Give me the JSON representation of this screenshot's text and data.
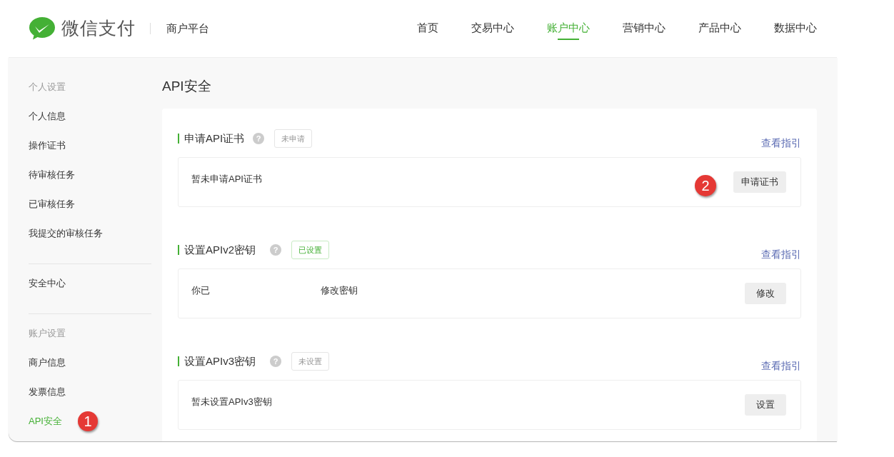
{
  "header": {
    "logo_text": "微信支付",
    "platform": "商户平台",
    "nav": [
      {
        "label": "首页",
        "selected": false
      },
      {
        "label": "交易中心",
        "selected": false
      },
      {
        "label": "账户中心",
        "selected": true
      },
      {
        "label": "营销中心",
        "selected": false
      },
      {
        "label": "产品中心",
        "selected": false
      },
      {
        "label": "数据中心",
        "selected": false
      }
    ]
  },
  "sidebar": {
    "groups": [
      {
        "heading": "个人设置",
        "items": [
          {
            "label": "个人信息",
            "selected": false
          },
          {
            "label": "操作证书",
            "selected": false
          },
          {
            "label": "待审核任务",
            "selected": false
          },
          {
            "label": "已审核任务",
            "selected": false
          },
          {
            "label": "我提交的审核任务",
            "selected": false
          }
        ]
      },
      {
        "items": [
          {
            "label": "安全中心",
            "selected": false
          }
        ]
      },
      {
        "heading": "账户设置",
        "items": [
          {
            "label": "商户信息",
            "selected": false
          },
          {
            "label": "发票信息",
            "selected": false
          },
          {
            "label": "API安全",
            "selected": true,
            "badge": "1"
          }
        ]
      }
    ]
  },
  "page_title": "API安全",
  "sections": [
    {
      "title": "申请API证书",
      "help": "?",
      "tag": {
        "text": "未申请",
        "set": false
      },
      "guide": "查看指引",
      "texts": [
        "暂未申请API证书"
      ],
      "button": "申请证书",
      "badge": "2"
    },
    {
      "title": "设置APIv2密钥",
      "help": "?",
      "tag": {
        "text": "已设置",
        "set": true
      },
      "guide": "查看指引",
      "texts": [
        "你已",
        "修改密钥"
      ],
      "button": "修改"
    },
    {
      "title": "设置APIv3密钥",
      "help": "?",
      "tag": {
        "text": "未设置",
        "set": false
      },
      "guide": "查看指引",
      "texts": [
        "暂未设置APIv3密钥"
      ],
      "button": "设置"
    }
  ]
}
